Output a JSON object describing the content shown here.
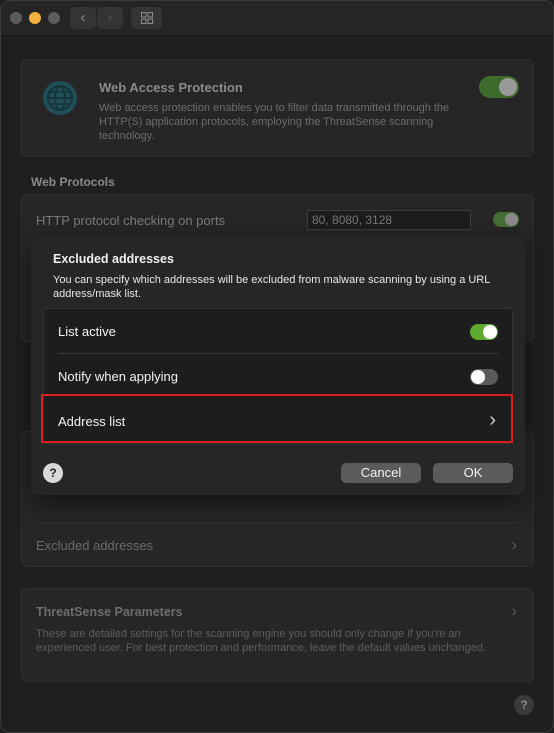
{
  "web_access": {
    "title": "Web Access Protection",
    "description": "Web access protection enables you to filter data transmitted through the HTTP(S) application protocols, employing the ThreatSense scanning technology.",
    "enabled": true
  },
  "web_protocols": {
    "section_title": "Web Protocols",
    "http_label": "HTTP protocol checking on ports",
    "ports_value": "80, 8080, 3128",
    "enabled": true
  },
  "lower_section": {
    "excluded_addresses_label": "Excluded addresses"
  },
  "threatsense": {
    "title": "ThreatSense Parameters",
    "description": "These are detailed settings for the scanning engine you should only change if you're an experienced user. For best protection and performance, leave the default values unchanged."
  },
  "sheet": {
    "title": "Excluded addresses",
    "description": "You can specify which addresses will be excluded from malware scanning by using a URL address/mask list.",
    "rows": [
      {
        "label": "List active",
        "toggle": "on"
      },
      {
        "label": "Notify when applying",
        "toggle": "off"
      },
      {
        "label": "Address list",
        "chevron": "chevron-right-icon"
      }
    ],
    "help_glyph": "?",
    "cancel_label": "Cancel",
    "ok_label": "OK"
  },
  "help_glyph": "?",
  "colors": {
    "highlight": "#d91c1c",
    "toggle_on": "#5ea92f",
    "minimize": "#f4b03d"
  }
}
